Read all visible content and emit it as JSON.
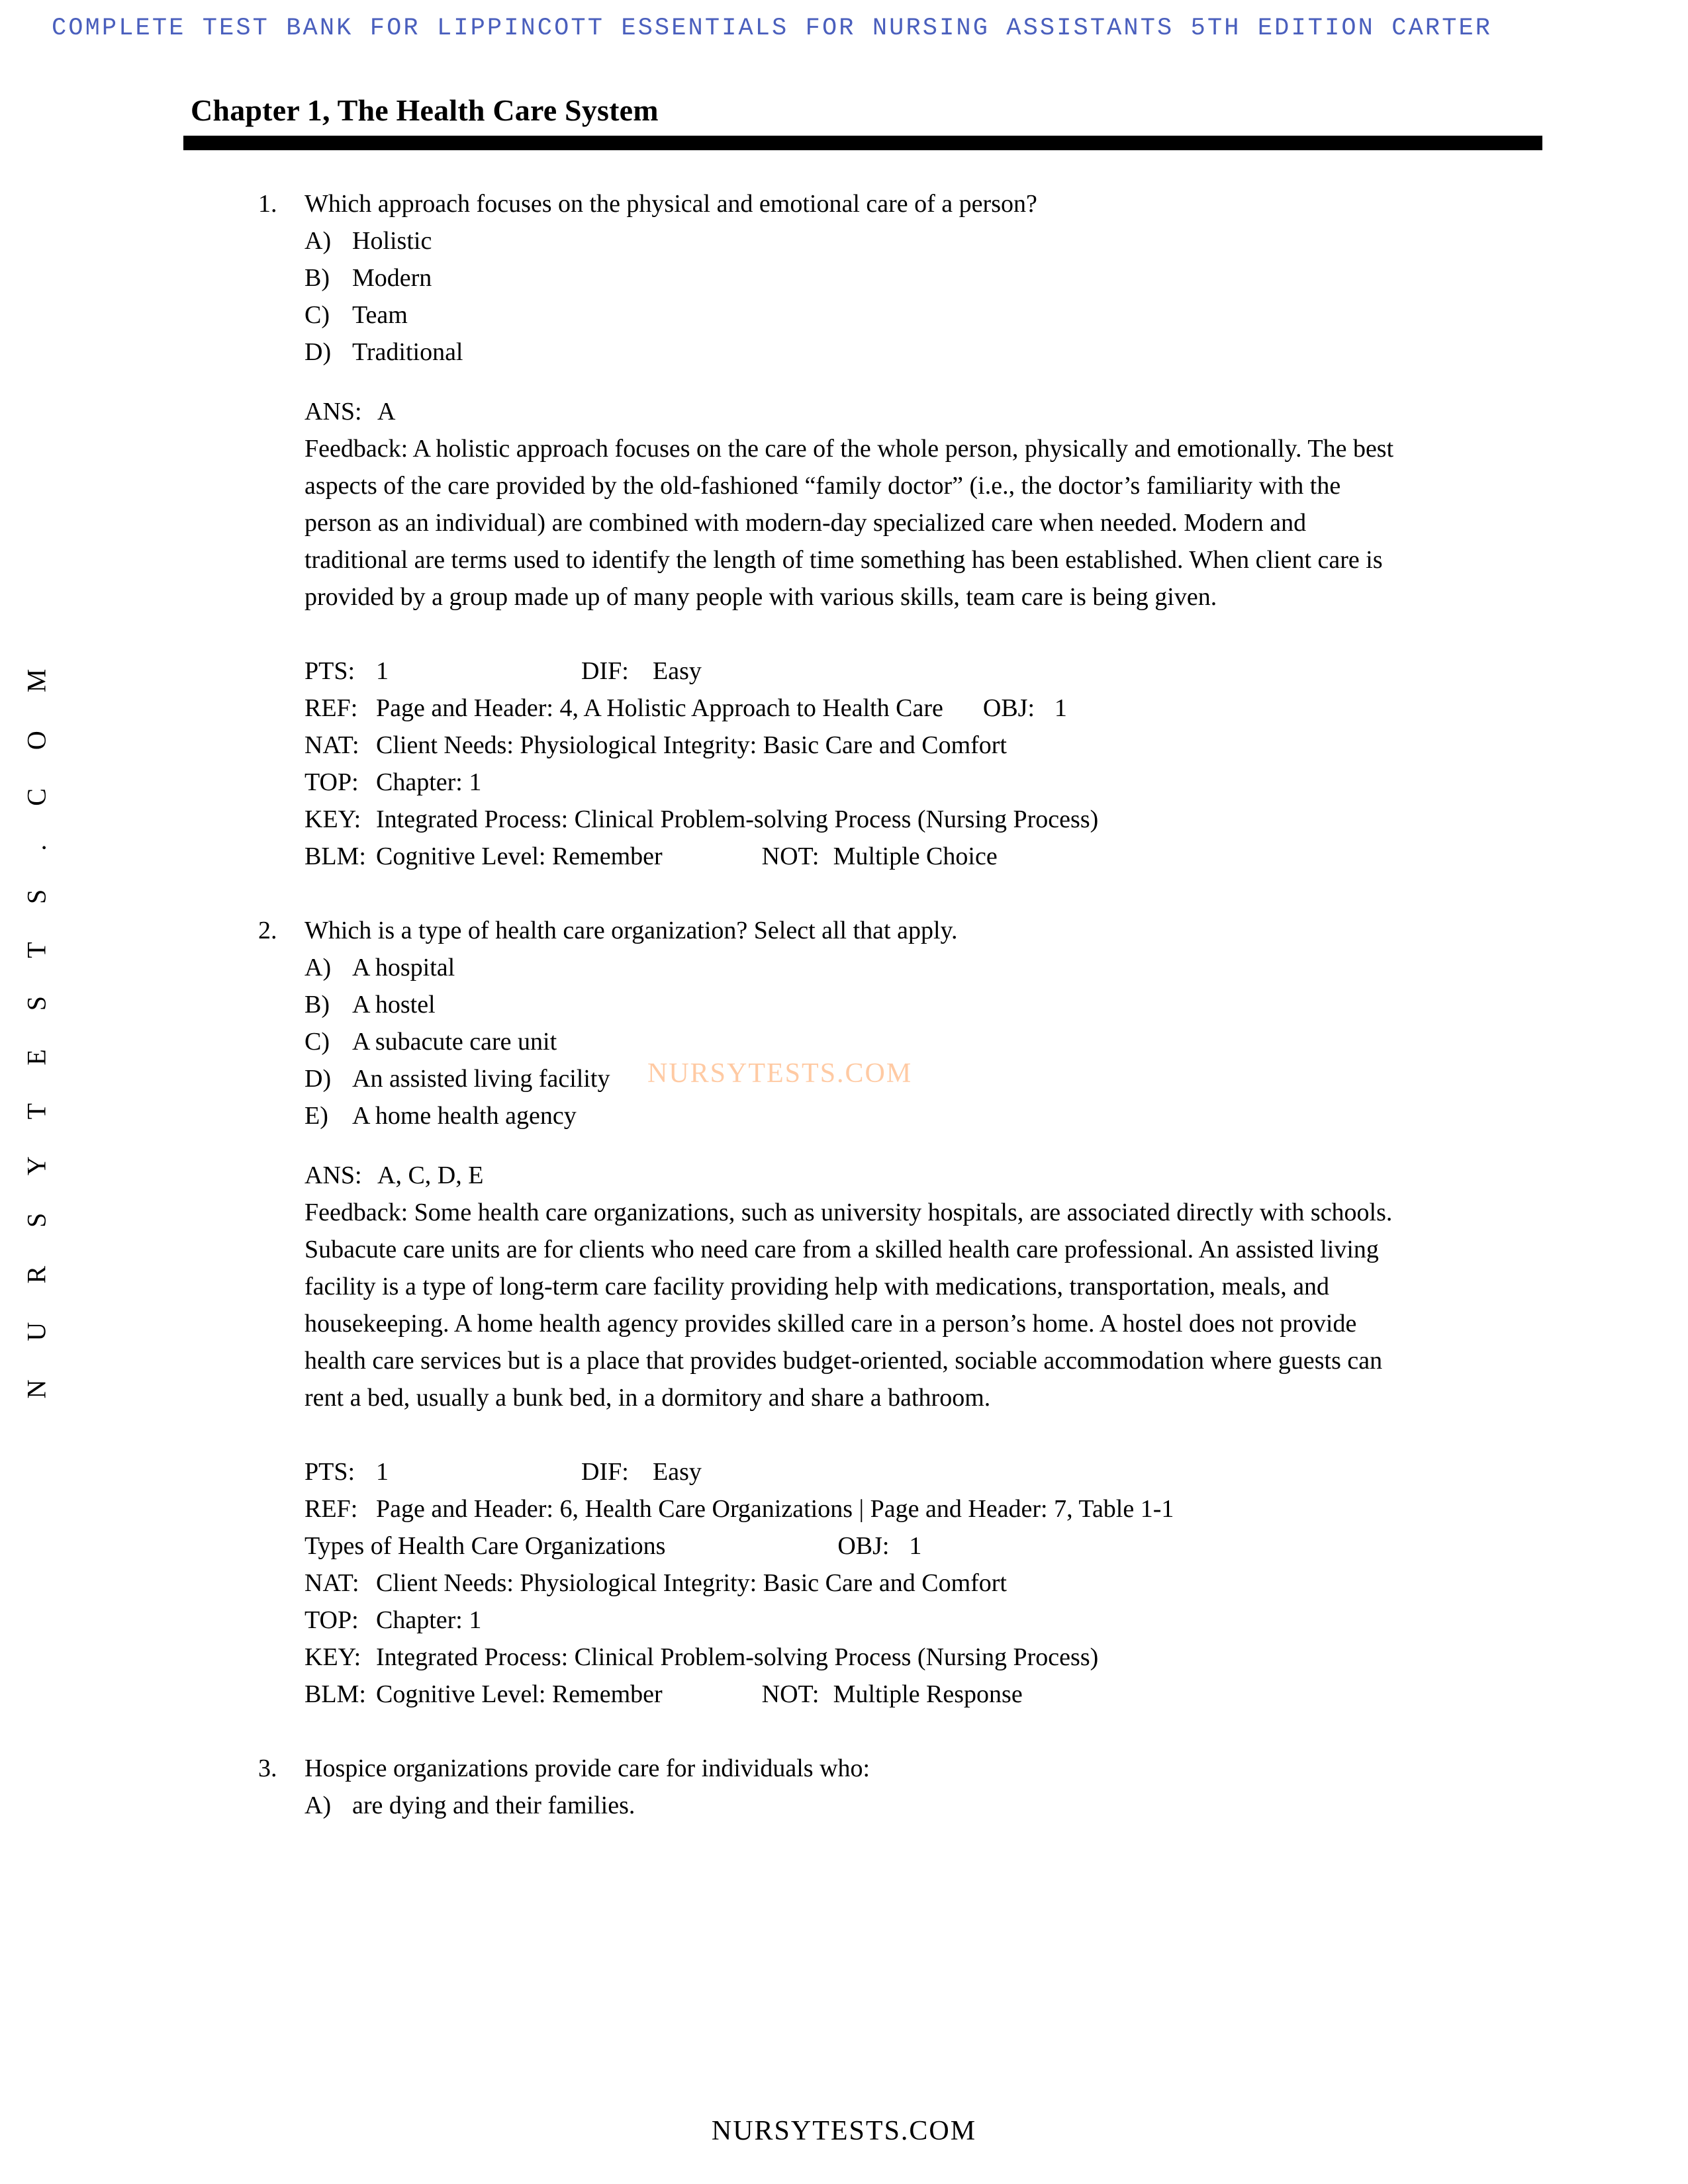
{
  "banner": {
    "text": "COMPLETE TEST BANK FOR LIPPINCOTT ESSENTIALS FOR NURSING ASSISTANTS 5TH EDITION CARTER",
    "color": "#4a5fbd"
  },
  "side_watermark": {
    "text": "N U R S Y T E S T S . C O M"
  },
  "center_watermark": {
    "text": "NURSYTESTS.COM",
    "color": "#ffcaa3"
  },
  "footer": {
    "text": "NURSYTESTS.COM"
  },
  "chapter": {
    "title": "Chapter 1, The Health Care System"
  },
  "questions": [
    {
      "number": "1.",
      "stem": "Which approach focuses on the physical and emotional care of a person?",
      "choices": [
        {
          "letter": "A)",
          "text": "Holistic"
        },
        {
          "letter": "B)",
          "text": "Modern"
        },
        {
          "letter": "C)",
          "text": "Team"
        },
        {
          "letter": "D)",
          "text": "Traditional"
        }
      ],
      "ans_label": "ANS:",
      "ans_value": "A",
      "feedback": "Feedback: A holistic approach focuses on the care of the whole person, physically and emotionally. The best aspects of the care provided by the old-fashioned “family doctor” (i.e., the doctor’s familiarity with the person as an individual) are combined with modern-day specialized care when needed. Modern and traditional are terms used to identify the length of time something has been established. When client care is provided by a group made up of many people with various skills, team care is being given.",
      "meta": {
        "pts_key": "PTS:",
        "pts_val": "1",
        "dif_key": "DIF:",
        "dif_val": "Easy",
        "ref_key": "REF:",
        "ref_val": "Page and Header: 4, A Holistic Approach to Health Care",
        "ref_val_cont": "",
        "obj_key": "OBJ:",
        "obj_val": "1",
        "nat_key": "NAT:",
        "nat_val": "Client Needs: Physiological Integrity: Basic Care and Comfort",
        "top_key": "TOP:",
        "top_val": "Chapter: 1",
        "key_key": "KEY:",
        "key_val": "Integrated Process: Clinical Problem-solving Process (Nursing Process)",
        "blm_key": "BLM:",
        "blm_val": "Cognitive Level: Remember",
        "not_key": "NOT:",
        "not_val": "Multiple Choice"
      }
    },
    {
      "number": "2.",
      "stem": "Which is a type of health care organization? Select all that apply.",
      "choices": [
        {
          "letter": "A)",
          "text": "A hospital"
        },
        {
          "letter": "B)",
          "text": "A hostel"
        },
        {
          "letter": "C)",
          "text": "A subacute care unit"
        },
        {
          "letter": "D)",
          "text": "An assisted living facility"
        },
        {
          "letter": "E)",
          "text": "A home health agency"
        }
      ],
      "ans_label": "ANS:",
      "ans_value": "A, C, D, E",
      "feedback": "Feedback: Some health care organizations, such as university hospitals, are associated directly with schools. Subacute care units are for clients who need care from a skilled health care professional. An assisted living facility is a type of long-term care facility providing help with medications, transportation, meals, and housekeeping. A home health agency provides skilled care in a person’s home. A hostel does not provide health care services but is a place that provides budget-oriented, sociable accommodation where guests can rent a bed, usually a bunk bed, in a dormitory and share a bathroom.",
      "meta": {
        "pts_key": "PTS:",
        "pts_val": "1",
        "dif_key": "DIF:",
        "dif_val": "Easy",
        "ref_key": "REF:",
        "ref_val": "Page and Header: 6, Health Care Organizations | Page and Header: 7, Table 1-1",
        "ref_val_cont": "Types of Health Care Organizations",
        "obj_key": "OBJ:",
        "obj_val": "1",
        "nat_key": "NAT:",
        "nat_val": "Client Needs: Physiological Integrity: Basic Care and Comfort",
        "top_key": "TOP:",
        "top_val": "Chapter: 1",
        "key_key": "KEY:",
        "key_val": "Integrated Process: Clinical Problem-solving Process (Nursing Process)",
        "blm_key": "BLM:",
        "blm_val": "Cognitive Level: Remember",
        "not_key": "NOT:",
        "not_val": "Multiple Response"
      }
    },
    {
      "number": "3.",
      "stem": "Hospice organizations provide care for individuals who:",
      "choices": [
        {
          "letter": "A)",
          "text": "are dying and their families."
        }
      ]
    }
  ]
}
